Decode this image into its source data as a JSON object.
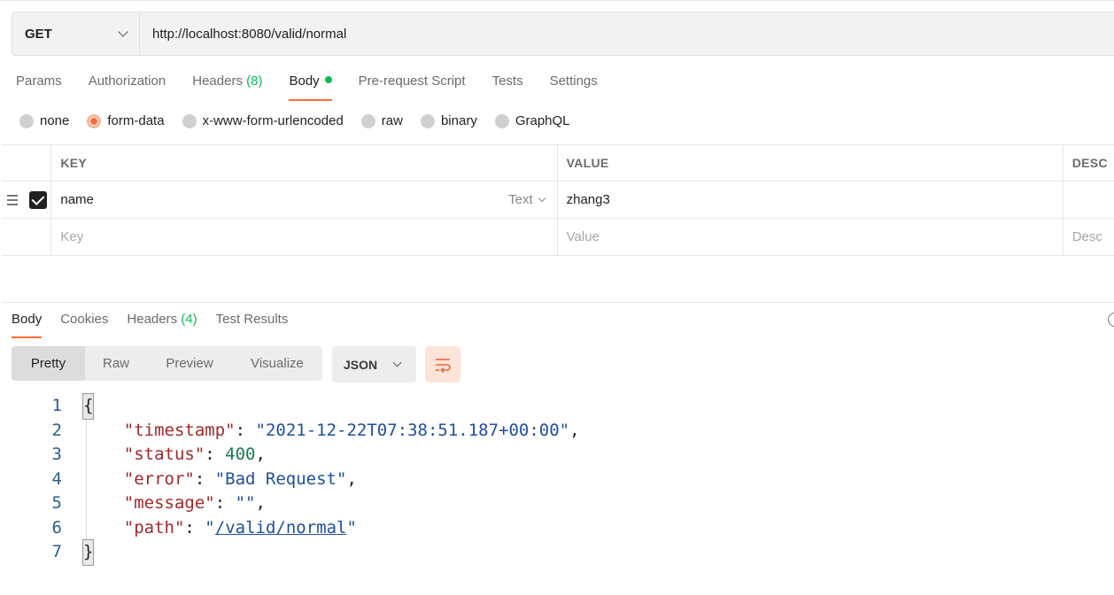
{
  "request": {
    "method": "GET",
    "url": "http://localhost:8080/valid/normal"
  },
  "request_tabs": [
    {
      "label": "Params"
    },
    {
      "label": "Authorization"
    },
    {
      "label": "Headers",
      "count": "(8)"
    },
    {
      "label": "Body",
      "active": true
    },
    {
      "label": "Pre-request Script"
    },
    {
      "label": "Tests"
    },
    {
      "label": "Settings"
    }
  ],
  "body_types": [
    "none",
    "form-data",
    "x-www-form-urlencoded",
    "raw",
    "binary",
    "GraphQL"
  ],
  "body_type_selected": "form-data",
  "params_table": {
    "headers": {
      "key": "KEY",
      "value": "VALUE",
      "description": "DESC"
    },
    "rows": [
      {
        "key": "name",
        "type": "Text",
        "value": "zhang3",
        "checked": true
      }
    ],
    "placeholder": {
      "key": "Key",
      "value": "Value",
      "description": "Desc"
    }
  },
  "response_tabs": [
    {
      "label": "Body",
      "active": true
    },
    {
      "label": "Cookies"
    },
    {
      "label": "Headers",
      "count": "(4)"
    },
    {
      "label": "Test Results"
    }
  ],
  "view_modes": [
    "Pretty",
    "Raw",
    "Preview",
    "Visualize"
  ],
  "view_mode_selected": "Pretty",
  "format": "JSON",
  "response_body": {
    "line_numbers": [
      "1",
      "2",
      "3",
      "4",
      "5",
      "6",
      "7"
    ],
    "open_brace": "{",
    "close_brace": "}",
    "fields": [
      {
        "key": "\"timestamp\"",
        "value": "\"2021-12-22T07:38:51.187+00:00\"",
        "kind": "string"
      },
      {
        "key": "\"status\"",
        "value": "400",
        "kind": "number"
      },
      {
        "key": "\"error\"",
        "value": "\"Bad Request\"",
        "kind": "string"
      },
      {
        "key": "\"message\"",
        "value": "\"\"",
        "kind": "string"
      },
      {
        "key": "\"path\"",
        "value": "/valid/normal",
        "kind": "link"
      }
    ]
  },
  "colors": {
    "accent": "#ff6c37",
    "success": "#0cbb52",
    "json_key": "#a0282b",
    "json_string": "#1f4f99",
    "json_number": "#1a7a4d"
  }
}
